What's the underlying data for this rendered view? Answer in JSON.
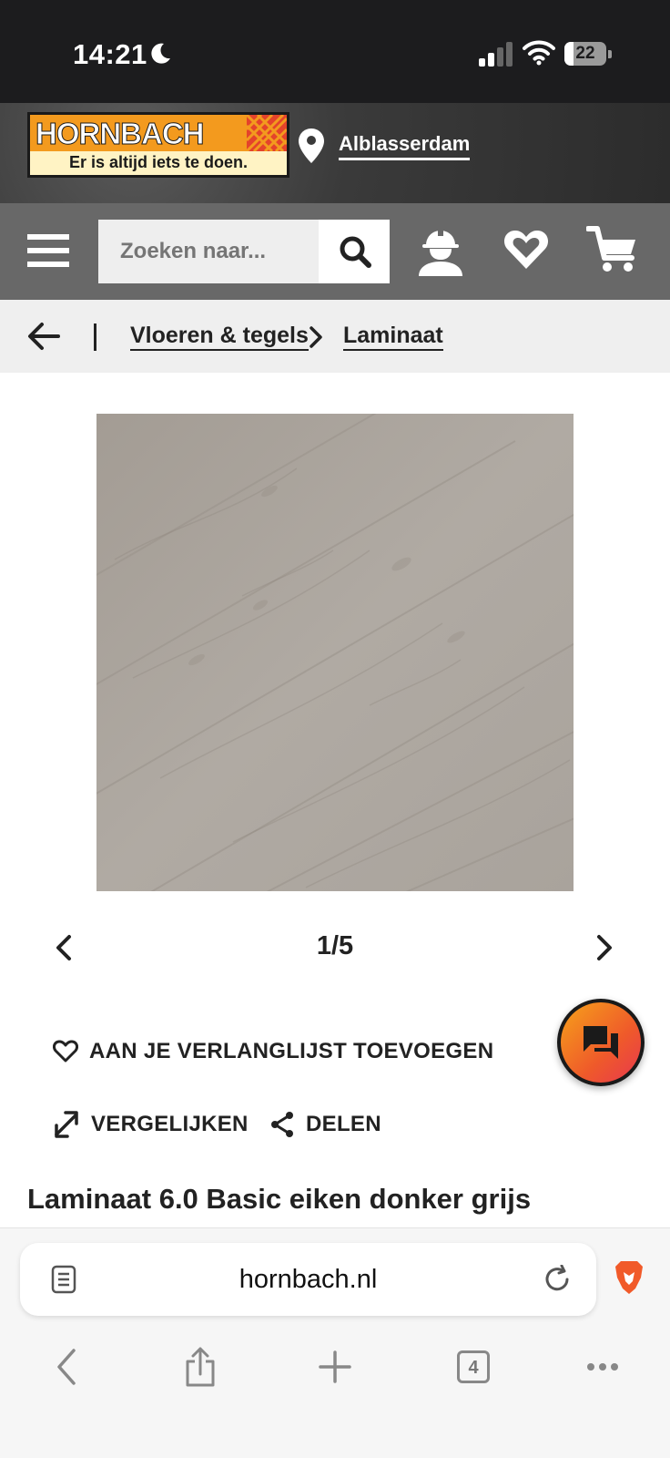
{
  "status_bar": {
    "time": "14:21",
    "battery_level": "22",
    "icons": [
      "moon-icon",
      "signal-icon",
      "wifi-icon",
      "battery-icon"
    ]
  },
  "brand": {
    "logo_text": "HORNBACH",
    "slogan": "Er is altijd iets te doen.",
    "store_location": "Alblasserdam",
    "colors": {
      "orange": "#f39a1e",
      "red": "#e4432b",
      "cream": "#fff3c4"
    }
  },
  "nav": {
    "search_placeholder": "Zoeken naar...",
    "icons": [
      "menu-icon",
      "search-icon",
      "account-icon",
      "wishlist-icon",
      "cart-icon"
    ]
  },
  "breadcrumb": {
    "items": [
      "Vloeren & tegels",
      "Laminaat"
    ]
  },
  "gallery": {
    "counter": "1/5"
  },
  "actions": {
    "wishlist": "AAN JE VERLANGLIJST TOEVOEGEN",
    "compare": "VERGELIJKEN",
    "share": "DELEN"
  },
  "product": {
    "title": "Laminaat 6.0 Basic eiken donker grijs"
  },
  "browser": {
    "url": "hornbach.nl",
    "tab_count": "4",
    "icons": [
      "reader-icon",
      "reload-icon",
      "brave-icon",
      "back-icon",
      "share-icon",
      "new-tab-icon",
      "tabs-icon",
      "more-icon"
    ]
  }
}
